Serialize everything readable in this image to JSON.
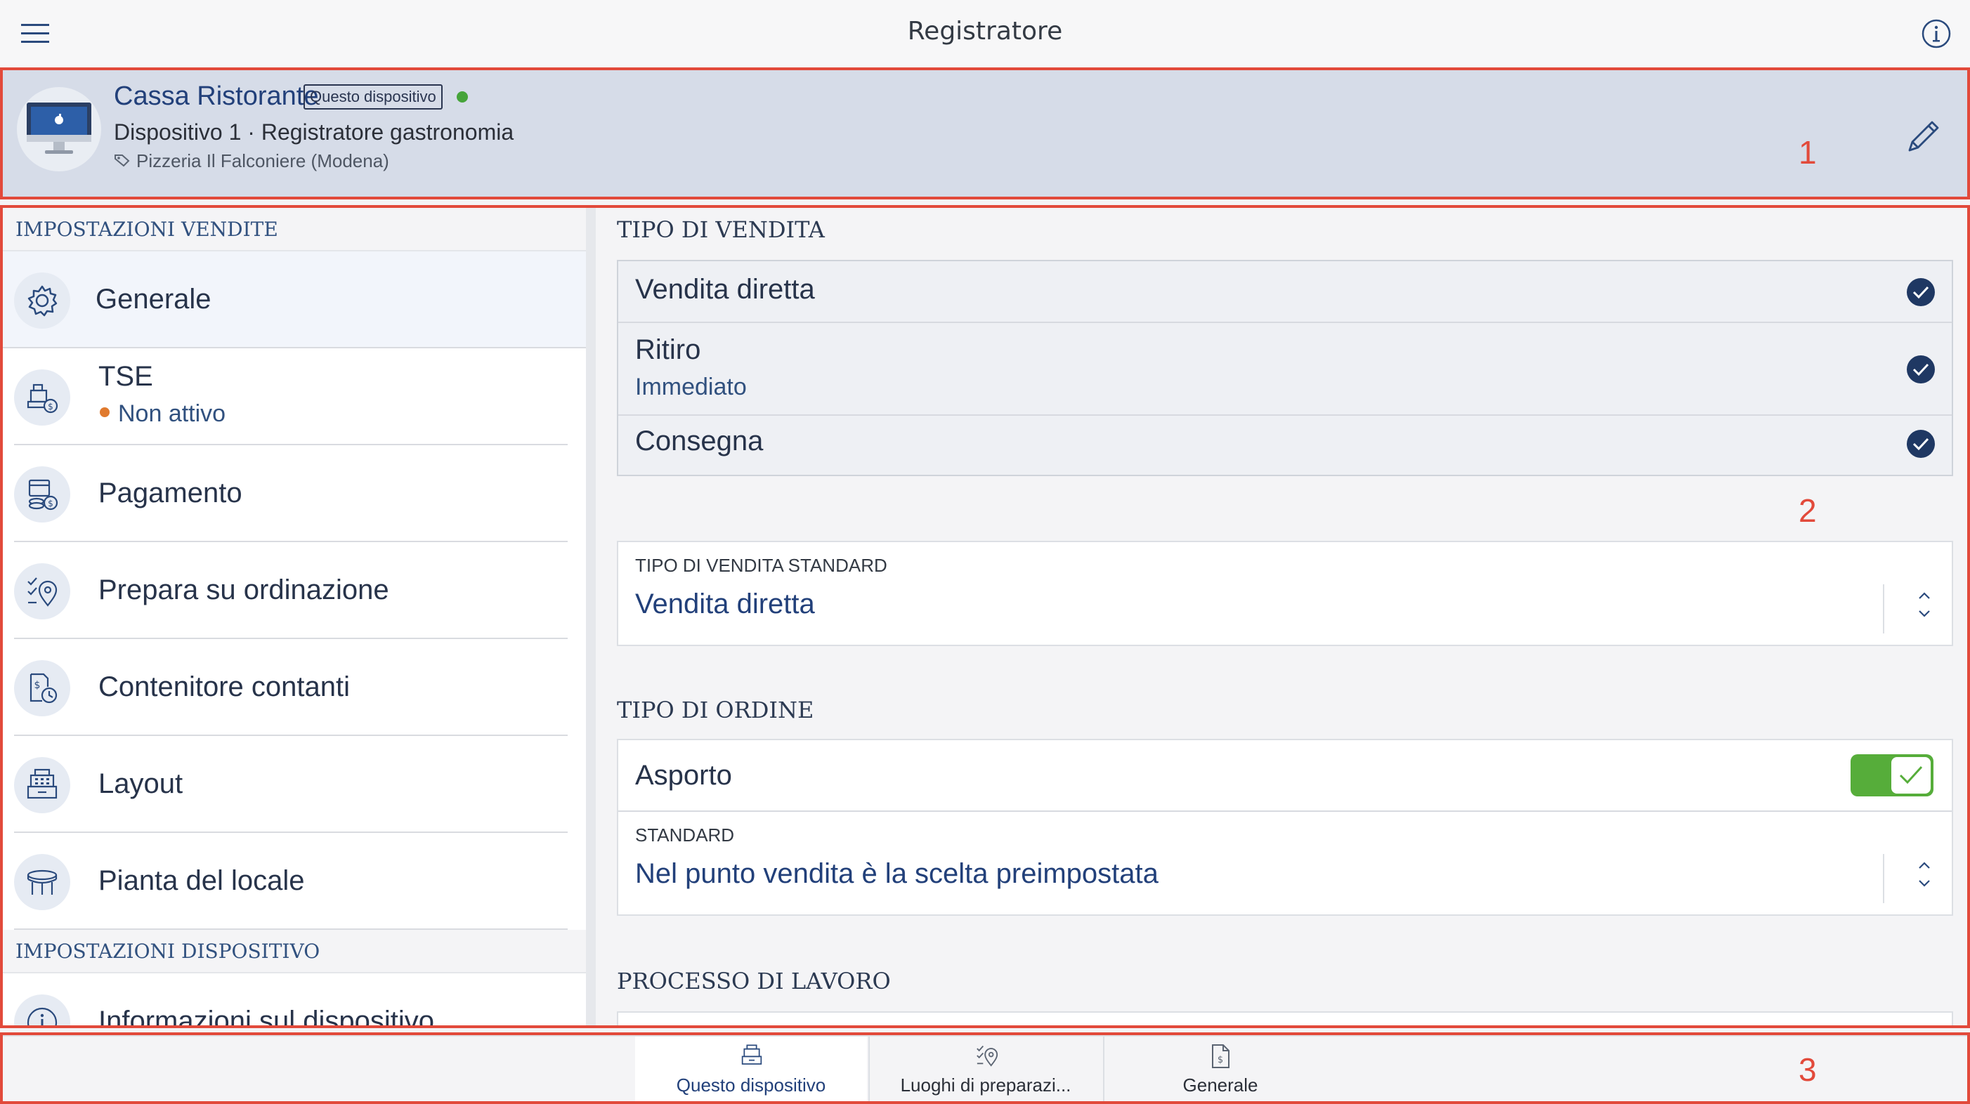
{
  "app": {
    "title": "Registratore"
  },
  "device": {
    "name": "Cassa Ristorante",
    "badge": "Questo dispositivo",
    "status_color": "#46a43a",
    "subtitle": "Dispositivo 1 · Registratore gastronomia",
    "location": "Pizzeria Il Falconiere (Modena)"
  },
  "sidebar": {
    "section_sales": "IMPOSTAZIONI VENDITE",
    "items": [
      {
        "label": "Generale",
        "icon": "gear-icon"
      },
      {
        "label": "TSE",
        "status": "Non attivo",
        "icon": "tse-icon"
      },
      {
        "label": "Pagamento",
        "icon": "payment-icon"
      },
      {
        "label": "Prepara su ordinazione",
        "icon": "prepare-icon"
      },
      {
        "label": "Contenitore contanti",
        "icon": "cash-drawer-icon"
      },
      {
        "label": "Layout",
        "icon": "register-icon"
      },
      {
        "label": "Pianta del locale",
        "icon": "table-icon"
      }
    ],
    "section_device": "IMPOSTAZIONI DISPOSITIVO",
    "device_items": [
      {
        "label": "Informazioni sul dispositivo",
        "icon": "info-icon"
      }
    ]
  },
  "main": {
    "sale_type_heading": "TIPO DI VENDITA",
    "sale_types": [
      {
        "label": "Vendita diretta",
        "checked": true
      },
      {
        "label": "Ritiro",
        "sub": "Immediato",
        "checked": true
      },
      {
        "label": "Consegna",
        "checked": true
      }
    ],
    "standard_sale_caption": "TIPO DI VENDITA STANDARD",
    "standard_sale_value": "Vendita diretta",
    "order_type_heading": "TIPO DI ORDINE",
    "takeaway_label": "Asporto",
    "takeaway_enabled": true,
    "standard_caption": "STANDARD",
    "standard_value": "Nel punto vendita è la scelta preimpostata",
    "work_process_heading": "PROCESSO DI LAVORO"
  },
  "tabs": [
    {
      "label": "Questo dispositivo",
      "icon": "register-icon",
      "active": true
    },
    {
      "label": "Luoghi di preparazi...",
      "icon": "prepare-icon",
      "active": false
    },
    {
      "label": "Generale",
      "icon": "document-icon",
      "active": false
    }
  ],
  "annotations": [
    "1",
    "2",
    "3"
  ],
  "colors": {
    "accent": "#22407a",
    "annotation": "#e24a3b",
    "toggle_on": "#56ad3a",
    "warning_dot": "#e07a2e"
  }
}
